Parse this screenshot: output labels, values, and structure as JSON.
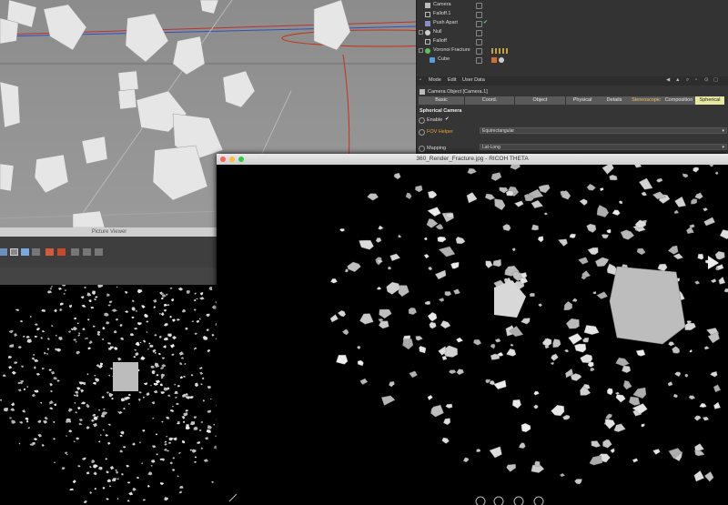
{
  "object_manager": {
    "objects": [
      {
        "name": "Camera",
        "icon": "camera-icon"
      },
      {
        "name": "Falloff.1",
        "icon": "falloff-icon"
      },
      {
        "name": "Push Apart",
        "icon": "push-apart-icon"
      },
      {
        "name": "Null",
        "icon": "null-icon"
      },
      {
        "name": "Falloff",
        "icon": "falloff-icon"
      },
      {
        "name": "Voronoi Fracture",
        "icon": "voronoi-fracture-icon"
      },
      {
        "name": "Cube",
        "icon": "cube-icon"
      }
    ]
  },
  "attribute_manager": {
    "menu": [
      "Mode",
      "Edit",
      "User Data"
    ],
    "object_title": "Camera Object [Camera.1]",
    "tabs": [
      "Basic",
      "Coord.",
      "Object",
      "Physical",
      "Details",
      "Stereoscopic",
      "Composition",
      "Spherical"
    ],
    "active_tab": "Spherical",
    "section_title": "Spherical Camera",
    "enable_label": "Enable",
    "enable_value": "✔",
    "fov_helper_label": "FOV Helper",
    "fov_helper_value": "Equirectangular",
    "mapping_label": "Mapping",
    "mapping_value": "Lat-Long"
  },
  "picture_viewer": {
    "title": "Picture Viewer"
  },
  "theta_viewer": {
    "title": "360_Render_Fracture.jpg - RICOH THETA"
  },
  "colors": {
    "viewport_bg": "#8e8e8e",
    "active_tab": "#e8e8a0",
    "traffic_close": "#fc605c",
    "traffic_min": "#fdbc40",
    "traffic_max": "#34c84a",
    "accent_orange": "#f0a030"
  }
}
